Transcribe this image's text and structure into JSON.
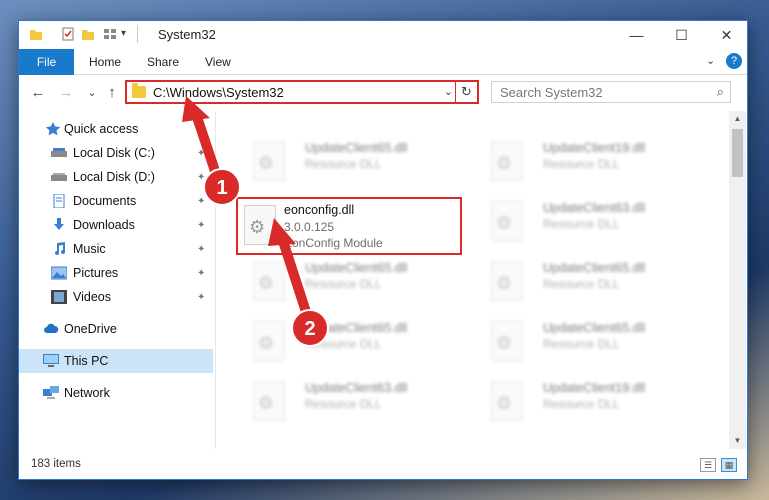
{
  "window": {
    "title": "System32",
    "controls": {
      "minimize": "—",
      "maximize": "☐",
      "close": "✕"
    }
  },
  "ribbon": {
    "tabs": [
      "File",
      "Home",
      "Share",
      "View"
    ],
    "help_icon": "?"
  },
  "navbar": {
    "back": "←",
    "forward": "→",
    "recent": "⌄",
    "up": "↑",
    "address_path": "C:\\Windows\\System32",
    "address_dropdown": "⌄",
    "refresh": "↻",
    "search_placeholder": "Search System32",
    "search_icon": "⌕"
  },
  "sidebar": {
    "items": [
      {
        "label": "Quick access",
        "icon": "star-icon",
        "pinned": false,
        "selected": false
      },
      {
        "label": "Local Disk (C:)",
        "icon": "drive-icon",
        "pinned": true,
        "selected": false
      },
      {
        "label": "Local Disk (D:)",
        "icon": "drive-icon",
        "pinned": true,
        "selected": false
      },
      {
        "label": "Documents",
        "icon": "documents-icon",
        "pinned": true,
        "selected": false
      },
      {
        "label": "Downloads",
        "icon": "download-icon",
        "pinned": true,
        "selected": false
      },
      {
        "label": "Music",
        "icon": "music-icon",
        "pinned": true,
        "selected": false
      },
      {
        "label": "Pictures",
        "icon": "pictures-icon",
        "pinned": true,
        "selected": false
      },
      {
        "label": "Videos",
        "icon": "videos-icon",
        "pinned": true,
        "selected": false
      },
      {
        "label": "OneDrive",
        "icon": "cloud-icon",
        "pinned": false,
        "selected": false
      },
      {
        "label": "This PC",
        "icon": "computer-icon",
        "pinned": false,
        "selected": true
      },
      {
        "label": "Network",
        "icon": "network-icon",
        "pinned": false,
        "selected": false
      }
    ],
    "pin_glyph": "📌"
  },
  "files": {
    "highlighted": {
      "name": "eonconfig.dll",
      "version": "3.0.0.125",
      "description": "EonConfig Module"
    },
    "others": [
      {
        "name": "UpdateClient65.dll",
        "type": "Resource DLL"
      },
      {
        "name": "UpdateClient19.dll",
        "type": "Resource DLL"
      },
      {
        "name": "UpdateClient63.dll",
        "type": "Resource DLL"
      },
      {
        "name": "UpdateClient65.dll",
        "type": "Resource DLL"
      },
      {
        "name": "UpdateClient65.dll",
        "type": "Resource DLL"
      },
      {
        "name": "UpdateClient65.dll",
        "type": "Resource DLL"
      },
      {
        "name": "UpdateClient65.dll",
        "type": "Resource DLL"
      },
      {
        "name": "UpdateClient63.dll",
        "type": "Resource DLL"
      },
      {
        "name": "UpdateClient19.dll",
        "type": "Resource DLL"
      }
    ]
  },
  "status": {
    "item_count": "183 items"
  },
  "annotations": {
    "badge_1": "1",
    "badge_2": "2",
    "color": "#d92a2a"
  }
}
